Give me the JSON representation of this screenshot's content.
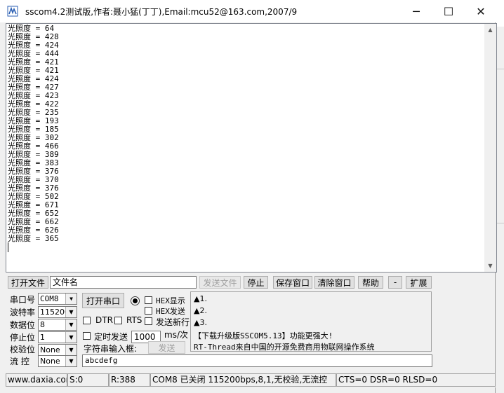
{
  "window": {
    "title": "sscom4.2测试版,作者:聂小猛(丁丁),Email:mcu52@163.com,2007/9",
    "minimize_glyph": "─",
    "maximize_glyph": "☐",
    "close_glyph": "✕"
  },
  "receive": {
    "lines": [
      "光照度 = 64",
      "光照度 = 428",
      "光照度 = 424",
      "光照度 = 444",
      "光照度 = 421",
      "光照度 = 421",
      "光照度 = 424",
      "光照度 = 427",
      "光照度 = 423",
      "光照度 = 422",
      "光照度 = 235",
      "光照度 = 193",
      "光照度 = 185",
      "光照度 = 302",
      "光照度 = 466",
      "光照度 = 389",
      "光照度 = 383",
      "光照度 = 376",
      "光照度 = 370",
      "光照度 = 376",
      "光照度 = 502",
      "光照度 = 671",
      "光照度 = 652",
      "光照度 = 662",
      "光照度 = 626",
      "光照度 = 365"
    ]
  },
  "toolbar": {
    "open_file": "打开文件",
    "filename_value": "文件名",
    "send_file": "发送文件",
    "stop": "停止",
    "save_window": "保存窗口",
    "clear_window": "清除窗口",
    "help": "帮助",
    "minus": "-",
    "expand": "扩展"
  },
  "settings": {
    "port_label": "串口号",
    "port_value": "COM8",
    "baud_label": "波特率",
    "baud_value": "115200",
    "databits_label": "数据位",
    "databits_value": "8",
    "stopbits_label": "停止位",
    "stopbits_value": "1",
    "parity_label": "校验位",
    "parity_value": "None",
    "flow_label": "流 控",
    "flow_value": "None"
  },
  "controls": {
    "open_port": "打开串口",
    "hex_display": "HEX显示",
    "hex_send": "HEX发送",
    "dtr": "DTR",
    "rts": "RTS",
    "send_newline": "发送新行",
    "timed_send": "定时发送",
    "interval_value": "1000",
    "interval_unit": "ms/次",
    "string_input_label": "字符串输入框:",
    "send": "发送",
    "input_value": "abcdefg"
  },
  "info": {
    "line1": "▲1.",
    "line2": "▲2.",
    "line3": "▲3.",
    "line4": "【下载升级版SSCOM5.13】功能更强大!",
    "line5": "RT-Thread来自中国的开源免费商用物联网操作系统"
  },
  "status": {
    "website": "www.daxia.com",
    "sent": "S:0",
    "received": "R:388",
    "port_status": "COM8 已关闭  115200bps,8,1,无校验,无流控",
    "lines": "CTS=0 DSR=0 RLSD=0"
  },
  "icons": {
    "dropdown": "chevron-down-icon",
    "app": "sscom-app-icon"
  }
}
